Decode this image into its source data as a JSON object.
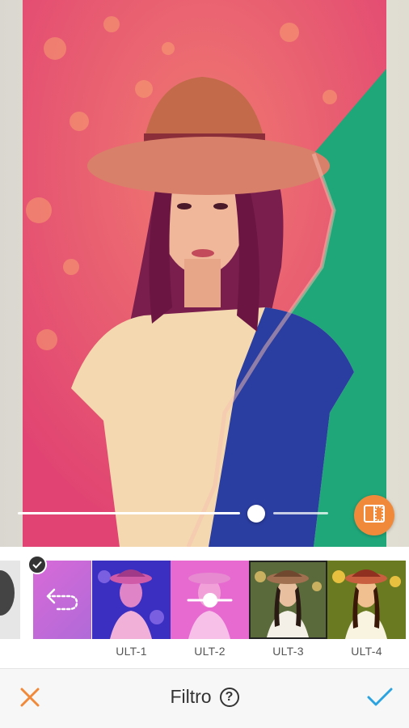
{
  "editor": {
    "compare_icon": "split-compare-icon",
    "intensity_slider": {
      "value": 0.74
    }
  },
  "filters": {
    "items": [
      {
        "label": "ULT-1"
      },
      {
        "label": "ULT-2"
      },
      {
        "label": "ULT-3"
      },
      {
        "label": "ULT-4"
      }
    ],
    "selected": "ULT-3",
    "undo_icon": "undo-icon"
  },
  "toolbar": {
    "title": "Filtro",
    "help_label": "?",
    "cancel_icon": "close-icon",
    "confirm_icon": "checkmark-icon"
  },
  "colors": {
    "accent": "#f08a3a",
    "confirm": "#2aa3e0",
    "cancel": "#f08a3a",
    "filter_pink": "#e8507a",
    "filter_green": "#1fa77a",
    "filter_blue": "#2a3da0"
  }
}
